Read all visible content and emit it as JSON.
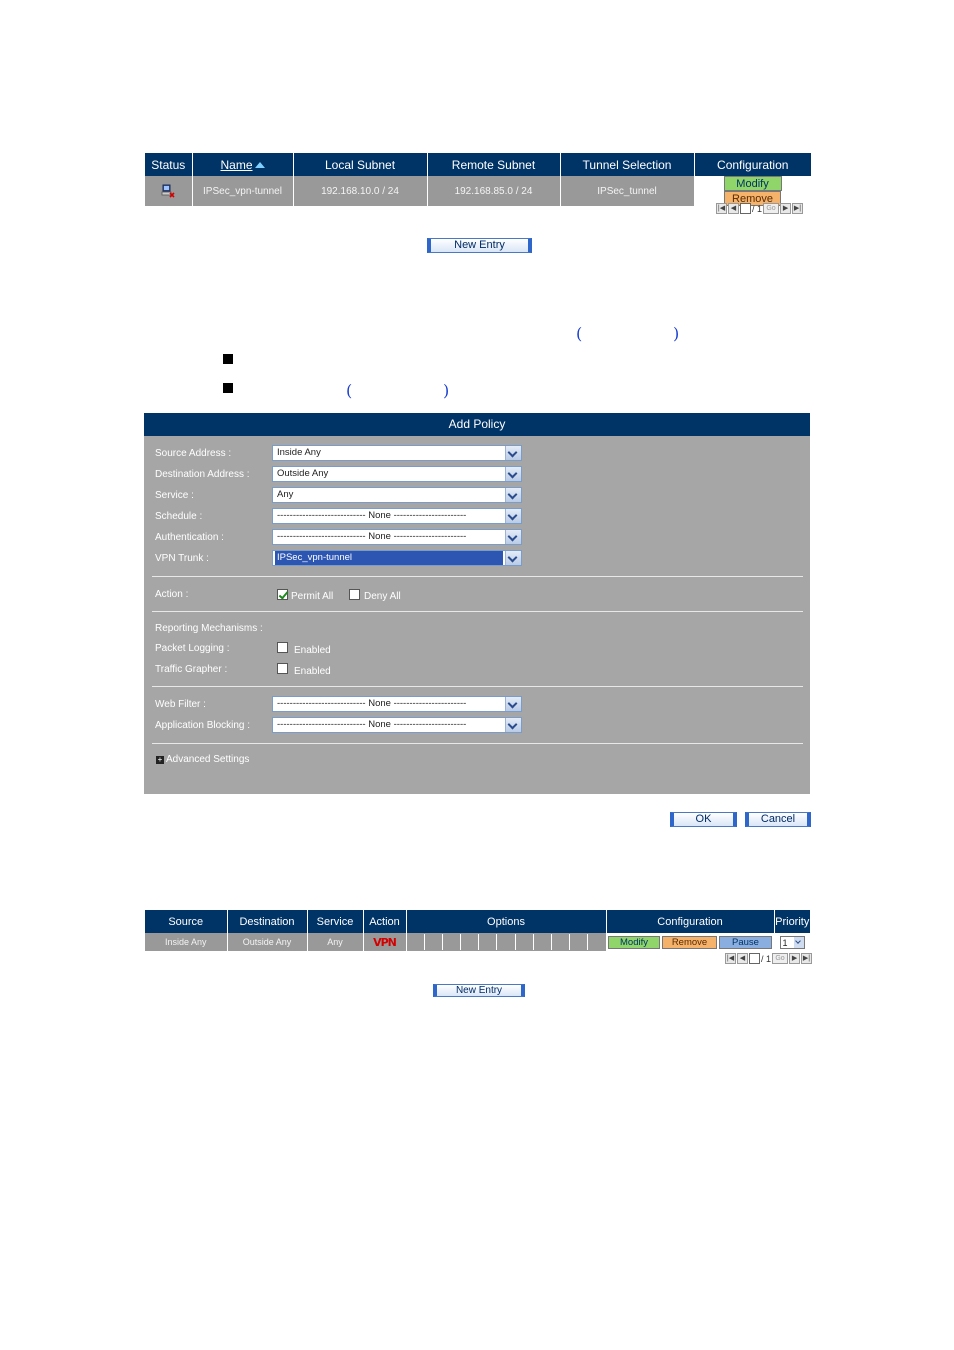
{
  "tunnel_table": {
    "headers": [
      "Status",
      "Name",
      "Local Subnet",
      "Remote Subnet",
      "Tunnel Selection",
      "Configuration"
    ],
    "rows": [
      {
        "status_icon": "tunnel-status-icon",
        "name": "IPSec_vpn-tunnel",
        "local_subnet": "192.168.10.0 / 24",
        "remote_subnet": "192.168.85.0 / 24",
        "tunnel_selection": "IPSec_tunnel",
        "modify": "Modify",
        "remove": "Remove"
      }
    ],
    "pager": {
      "total": "/ 1",
      "go": "Go"
    },
    "new_entry": "New Entry"
  },
  "add_policy": {
    "title": "Add Policy",
    "fields": [
      {
        "label": "Source Address :",
        "value": "Inside Any"
      },
      {
        "label": "Destination Address :",
        "value": "Outside Any"
      },
      {
        "label": "Service :",
        "value": "Any"
      },
      {
        "label": "Schedule :",
        "value": "---------------------------- None -----------------------"
      },
      {
        "label": "Authentication :",
        "value": "---------------------------- None -----------------------"
      },
      {
        "label": "VPN Trunk :",
        "value": "IPSec_vpn-tunnel"
      }
    ],
    "action": {
      "label": "Action :",
      "permit": "Permit All",
      "deny": "Deny All",
      "permit_checked": true,
      "deny_checked": false
    },
    "reporting": {
      "label": "Reporting Mechanisms :",
      "packet_logging": "Packet Logging :",
      "traffic_grapher": "Traffic Grapher :",
      "enabled": "Enabled"
    },
    "web_filter": {
      "label": "Web Filter :",
      "value": "---------------------------- None -----------------------"
    },
    "app_blocking": {
      "label": "Application Blocking :",
      "value": "---------------------------- None -----------------------"
    },
    "advanced": "Advanced Settings",
    "ok": "OK",
    "cancel": "Cancel"
  },
  "policy_table": {
    "headers": [
      "Source",
      "Destination",
      "Service",
      "Action",
      "Options",
      "Configuration",
      "Priority"
    ],
    "rows": [
      {
        "source": "Inside Any",
        "destination": "Outside Any",
        "service": "Any",
        "action_badge": "VPN",
        "modify": "Modify",
        "remove": "Remove",
        "pause": "Pause",
        "priority": "1"
      }
    ],
    "pager": {
      "total": "/ 1",
      "go": "Go"
    },
    "new_entry": "New Entry"
  },
  "colors": {
    "header_bg": "#003366",
    "row_bg": "#999999",
    "panel_bg": "#a6a6a6",
    "modify": "#8fd56a",
    "remove": "#f5b26a",
    "pause": "#8aaee0"
  }
}
